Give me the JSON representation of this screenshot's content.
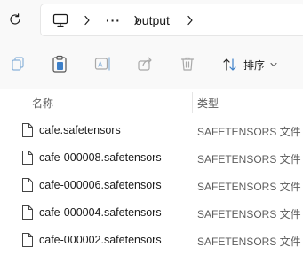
{
  "address_bar": {
    "refresh_icon": "refresh-icon",
    "computer_icon": "computer-icon",
    "ellipsis": "···",
    "current_folder": "output"
  },
  "toolbar": {
    "buttons": [
      "copy-icon",
      "paste-icon",
      "rename-icon",
      "share-icon",
      "delete-icon"
    ],
    "sort_label": "排序"
  },
  "columns": {
    "name": "名称",
    "type": "类型"
  },
  "files": [
    {
      "name": "cafe.safetensors",
      "type": "SAFETENSORS 文件"
    },
    {
      "name": "cafe-000008.safetensors",
      "type": "SAFETENSORS 文件"
    },
    {
      "name": "cafe-000006.safetensors",
      "type": "SAFETENSORS 文件"
    },
    {
      "name": "cafe-000004.safetensors",
      "type": "SAFETENSORS 文件"
    },
    {
      "name": "cafe-000002.safetensors",
      "type": "SAFETENSORS 文件"
    }
  ]
}
